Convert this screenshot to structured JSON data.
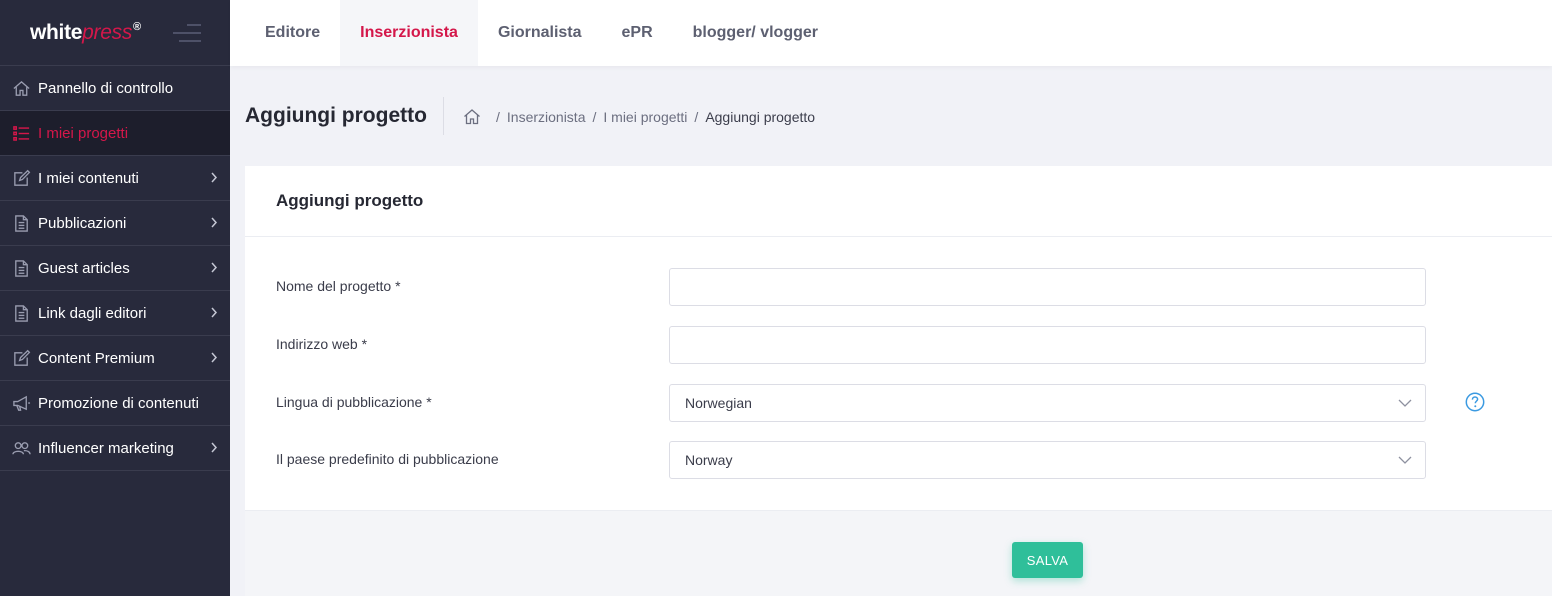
{
  "brand": {
    "white": "white",
    "press": "press",
    "reg": "®"
  },
  "sidebar": {
    "items": [
      {
        "label": "Pannello di controllo",
        "icon": "home-icon",
        "chevron": false,
        "active": false
      },
      {
        "label": "I miei progetti",
        "icon": "list-icon",
        "chevron": false,
        "active": true
      },
      {
        "label": "I miei contenuti",
        "icon": "edit-icon",
        "chevron": true,
        "active": false
      },
      {
        "label": "Pubblicazioni",
        "icon": "document-icon",
        "chevron": true,
        "active": false
      },
      {
        "label": "Guest articles",
        "icon": "document-icon",
        "chevron": true,
        "active": false
      },
      {
        "label": "Link dagli editori",
        "icon": "document-icon",
        "chevron": true,
        "active": false
      },
      {
        "label": "Content Premium",
        "icon": "edit-icon",
        "chevron": true,
        "active": false
      },
      {
        "label": "Promozione di contenuti",
        "icon": "megaphone-icon",
        "chevron": false,
        "active": false
      },
      {
        "label": "Influencer marketing",
        "icon": "users-icon",
        "chevron": true,
        "active": false
      }
    ]
  },
  "topbar": {
    "tabs": [
      {
        "label": "Editore",
        "active": false
      },
      {
        "label": "Inserzionista",
        "active": true
      },
      {
        "label": "Giornalista",
        "active": false
      },
      {
        "label": "ePR",
        "active": false
      },
      {
        "label": "blogger/ vlogger",
        "active": false
      }
    ]
  },
  "page": {
    "title": "Aggiungi progetto",
    "breadcrumb": [
      "Inserzionista",
      "I miei progetti",
      "Aggiungi progetto"
    ],
    "breadcrumb_sep": "/"
  },
  "form": {
    "heading": "Aggiungi progetto",
    "fields": [
      {
        "label": "Nome del progetto *",
        "type": "text",
        "value": ""
      },
      {
        "label": "Indirizzo web *",
        "type": "text",
        "value": ""
      },
      {
        "label": "Lingua di pubblicazione *",
        "type": "select",
        "value": "Norwegian"
      },
      {
        "label": "Il paese predefinito di pubblicazione",
        "type": "select",
        "value": "Norway"
      }
    ],
    "save_label": "SALVA"
  },
  "colors": {
    "accent": "#d4174a",
    "sidebar_bg": "#282a3c",
    "save_button": "#2fbf9a",
    "help_icon": "#3b9ae1"
  }
}
